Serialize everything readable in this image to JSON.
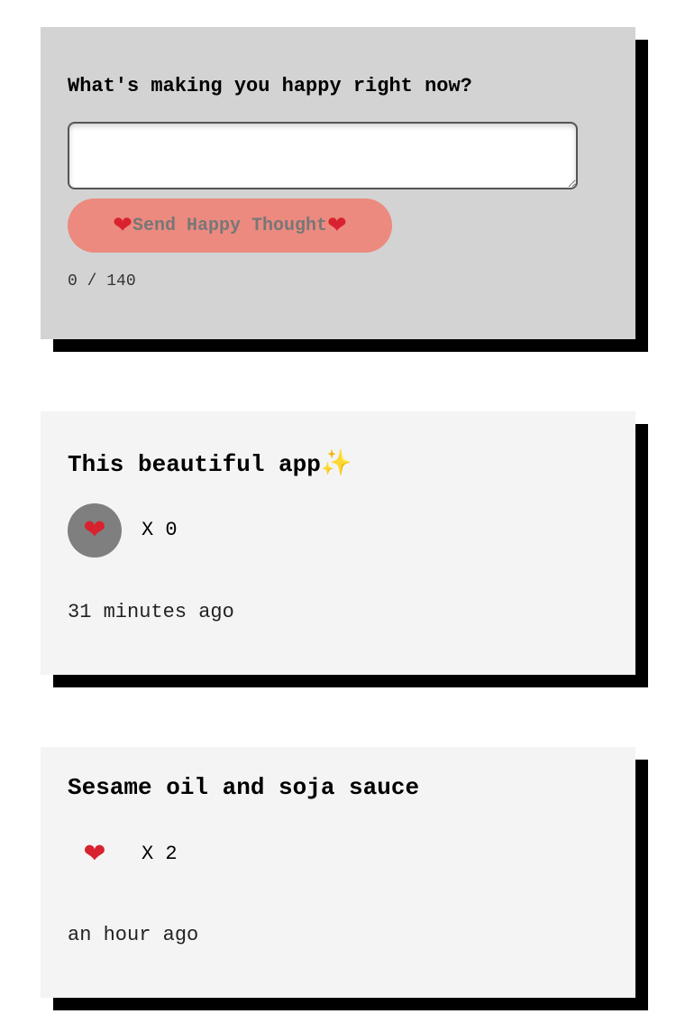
{
  "form": {
    "question": "What's making you happy right now?",
    "input_value": "",
    "send_button_label": "Send Happy Thought",
    "char_count": "0",
    "char_separator": " / ",
    "char_limit": "140"
  },
  "thoughts": [
    {
      "text": "This beautiful app",
      "emoji": "✨",
      "like_prefix": "X ",
      "likes": "0",
      "time": "31 minutes ago"
    },
    {
      "text": "Sesame oil and soja sauce",
      "like_prefix": "X ",
      "likes": "2",
      "time": "an hour ago"
    }
  ],
  "icons": {
    "heart": "❤",
    "sparkles": "sparkles-icon"
  },
  "colors": {
    "form_background": "#d3d3d3",
    "card_background": "#f4f4f4",
    "send_button": "#ec8a7f",
    "liked_button": "#7f7f7f",
    "shadow": "#000000",
    "heart": "#d8222f"
  }
}
